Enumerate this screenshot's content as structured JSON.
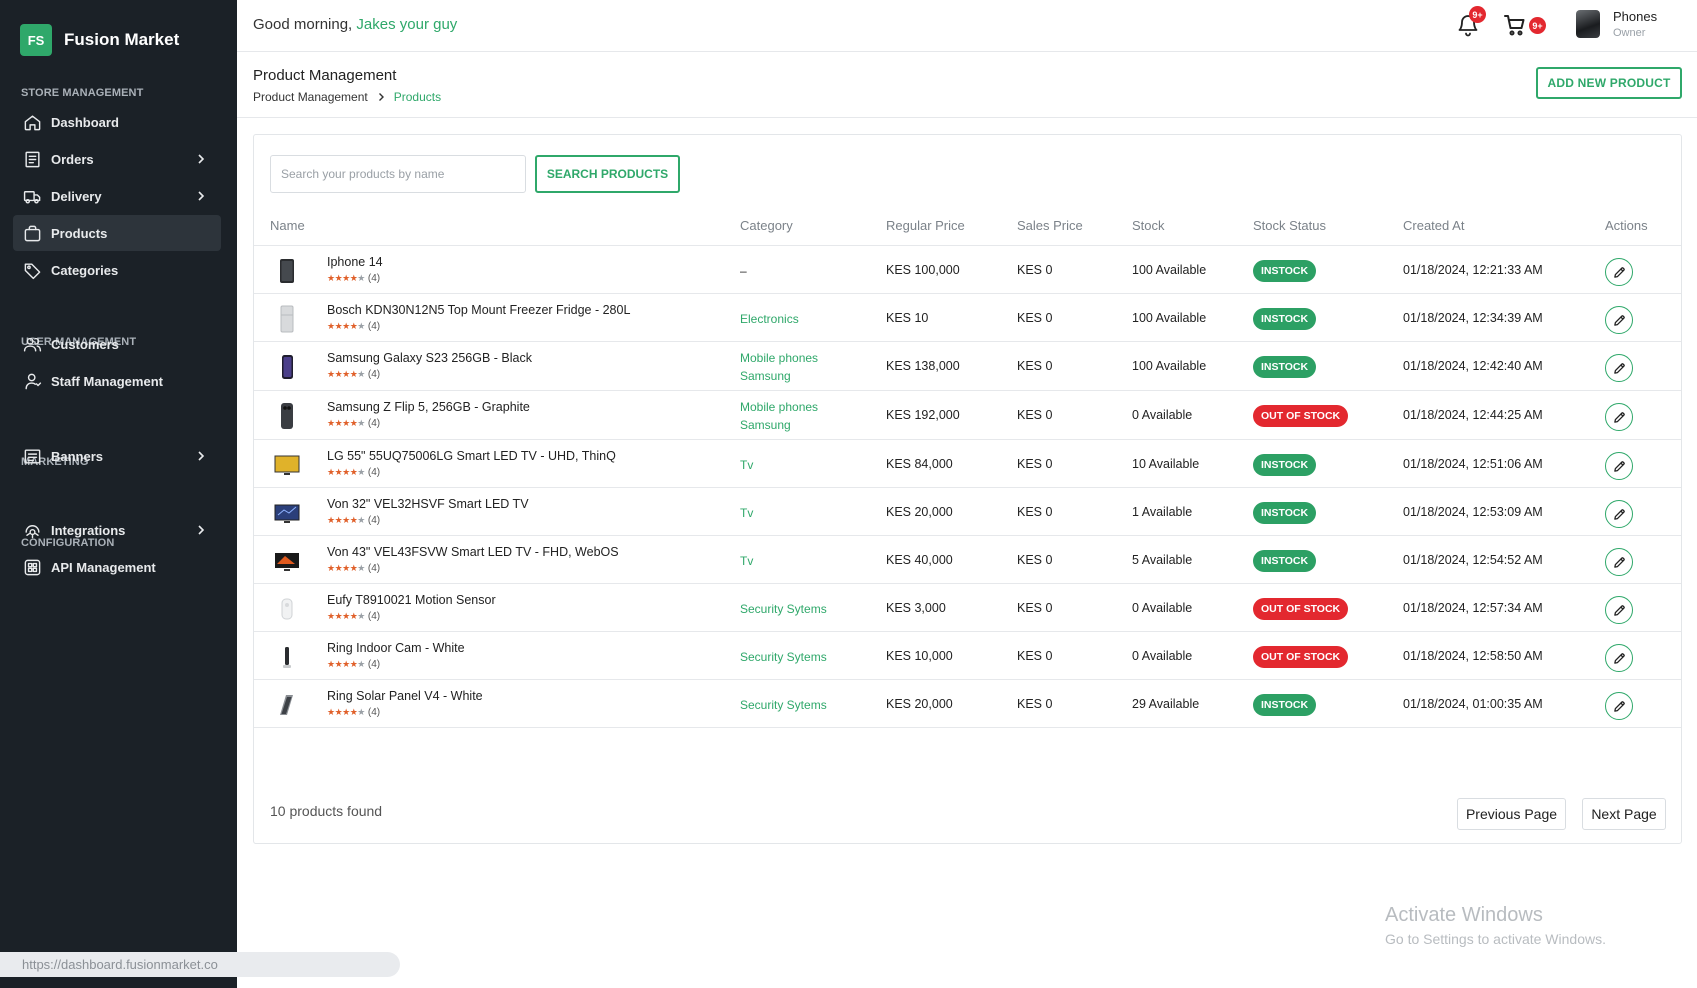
{
  "brand": {
    "logo": "FS",
    "name": "Fusion Market"
  },
  "sidebar": {
    "sections": {
      "store": "STORE MANAGEMENT",
      "user": "USER MANAGEMENT",
      "marketing": "MARKETING",
      "config": "CONFIGURATION"
    },
    "items": [
      {
        "label": "Dashboard",
        "icon": "home-icon",
        "chevron": false,
        "active": false
      },
      {
        "label": "Orders",
        "icon": "receipt-icon",
        "chevron": true,
        "active": false
      },
      {
        "label": "Delivery",
        "icon": "truck-icon",
        "chevron": true,
        "active": false
      },
      {
        "label": "Products",
        "icon": "bag-icon",
        "chevron": false,
        "active": true
      },
      {
        "label": "Categories",
        "icon": "tag-icon",
        "chevron": false,
        "active": false
      },
      {
        "label": "Customers",
        "icon": "users-icon",
        "chevron": false,
        "active": false
      },
      {
        "label": "Staff Management",
        "icon": "user-icon",
        "chevron": false,
        "active": false
      },
      {
        "label": "Banners",
        "icon": "banner-icon",
        "chevron": true,
        "active": false
      },
      {
        "label": "Integrations",
        "icon": "integration-icon",
        "chevron": true,
        "active": false
      },
      {
        "label": "API Management",
        "icon": "api-icon",
        "chevron": false,
        "active": false
      }
    ],
    "status_url": "https://dashboard.fusionmarket.co"
  },
  "header": {
    "greeting": "Good morning,",
    "user_highlight": "Jakes your guy",
    "notifications_badge": "9+",
    "cart_badge": "9+",
    "user_name": "Phones",
    "user_role": "Owner"
  },
  "page": {
    "title": "Product Management",
    "breadcrumb": [
      "Product Management",
      "Products"
    ],
    "add_button": "ADD NEW PRODUCT"
  },
  "search": {
    "placeholder": "Search your products by name",
    "button": "SEARCH PRODUCTS"
  },
  "table": {
    "columns": [
      "Name",
      "Category",
      "Regular Price",
      "Sales Price",
      "Stock",
      "Stock Status",
      "Created At",
      "Actions"
    ],
    "rows": [
      {
        "name": "Iphone 14",
        "rating": 4,
        "reviews": "(4)",
        "category": [
          "–"
        ],
        "regular_price": "KES 100,000",
        "sales_price": "KES 0",
        "stock": "100 Available",
        "status": "INSTOCK",
        "created": "01/18/2024, 12:21:33 AM",
        "thumb": "phone-dark"
      },
      {
        "name": "Bosch KDN30N12N5 Top Mount Freezer Fridge - 280L",
        "rating": 4,
        "reviews": "(4)",
        "category": [
          "Electronics"
        ],
        "regular_price": "KES 10",
        "sales_price": "KES 0",
        "stock": "100 Available",
        "status": "INSTOCK",
        "created": "01/18/2024, 12:34:39 AM",
        "thumb": "fridge"
      },
      {
        "name": "Samsung Galaxy S23 256GB - Black",
        "rating": 4,
        "reviews": "(4)",
        "category": [
          "Mobile phones",
          "Samsung"
        ],
        "regular_price": "KES 138,000",
        "sales_price": "KES 0",
        "stock": "100 Available",
        "status": "INSTOCK",
        "created": "01/18/2024, 12:42:40 AM",
        "thumb": "phone-purple"
      },
      {
        "name": "Samsung Z Flip 5, 256GB - Graphite",
        "rating": 4,
        "reviews": "(4)",
        "category": [
          "Mobile phones",
          "Samsung"
        ],
        "regular_price": "KES 192,000",
        "sales_price": "KES 0",
        "stock": "0 Available",
        "status": "OUT OF STOCK",
        "created": "01/18/2024, 12:44:25 AM",
        "thumb": "phone-flip"
      },
      {
        "name": "LG 55\" 55UQ75006LG Smart LED TV - UHD, ThinQ",
        "rating": 4,
        "reviews": "(4)",
        "category": [
          "Tv"
        ],
        "regular_price": "KES 84,000",
        "sales_price": "KES 0",
        "stock": "10 Available",
        "status": "INSTOCK",
        "created": "01/18/2024, 12:51:06 AM",
        "thumb": "tv-yellow"
      },
      {
        "name": "Von 32\" VEL32HSVF Smart LED TV",
        "rating": 4,
        "reviews": "(4)",
        "category": [
          "Tv"
        ],
        "regular_price": "KES 20,000",
        "sales_price": "KES 0",
        "stock": "1 Available",
        "status": "INSTOCK",
        "created": "01/18/2024, 12:53:09 AM",
        "thumb": "tv-blue"
      },
      {
        "name": "Von 43\" VEL43FSVW Smart LED TV - FHD, WebOS",
        "rating": 4,
        "reviews": "(4)",
        "category": [
          "Tv"
        ],
        "regular_price": "KES 40,000",
        "sales_price": "KES 0",
        "stock": "5 Available",
        "status": "INSTOCK",
        "created": "01/18/2024, 12:54:52 AM",
        "thumb": "tv-orange"
      },
      {
        "name": "Eufy T8910021 Motion Sensor",
        "rating": 4,
        "reviews": "(4)",
        "category": [
          "Security Sytems"
        ],
        "regular_price": "KES 3,000",
        "sales_price": "KES 0",
        "stock": "0 Available",
        "status": "OUT OF STOCK",
        "created": "01/18/2024, 12:57:34 AM",
        "thumb": "sensor"
      },
      {
        "name": "Ring Indoor Cam - White",
        "rating": 4,
        "reviews": "(4)",
        "category": [
          "Security Sytems"
        ],
        "regular_price": "KES 10,000",
        "sales_price": "KES 0",
        "stock": "0 Available",
        "status": "OUT OF STOCK",
        "created": "01/18/2024, 12:58:50 AM",
        "thumb": "cam"
      },
      {
        "name": "Ring Solar Panel V4 - White",
        "rating": 4,
        "reviews": "(4)",
        "category": [
          "Security Sytems"
        ],
        "regular_price": "KES 20,000",
        "sales_price": "KES 0",
        "stock": "29 Available",
        "status": "INSTOCK",
        "created": "01/18/2024, 01:00:35 AM",
        "thumb": "panel"
      }
    ]
  },
  "footer": {
    "count": "10 products found",
    "prev": "Previous Page",
    "next": "Next Page"
  },
  "watermark": {
    "line1": "Activate Windows",
    "line2": "Go to Settings to activate Windows."
  },
  "colors": {
    "accent": "#2fa86a",
    "sidebar_bg": "#1b2127",
    "instock": "#2ca064",
    "out_of_stock": "#e3282f"
  }
}
